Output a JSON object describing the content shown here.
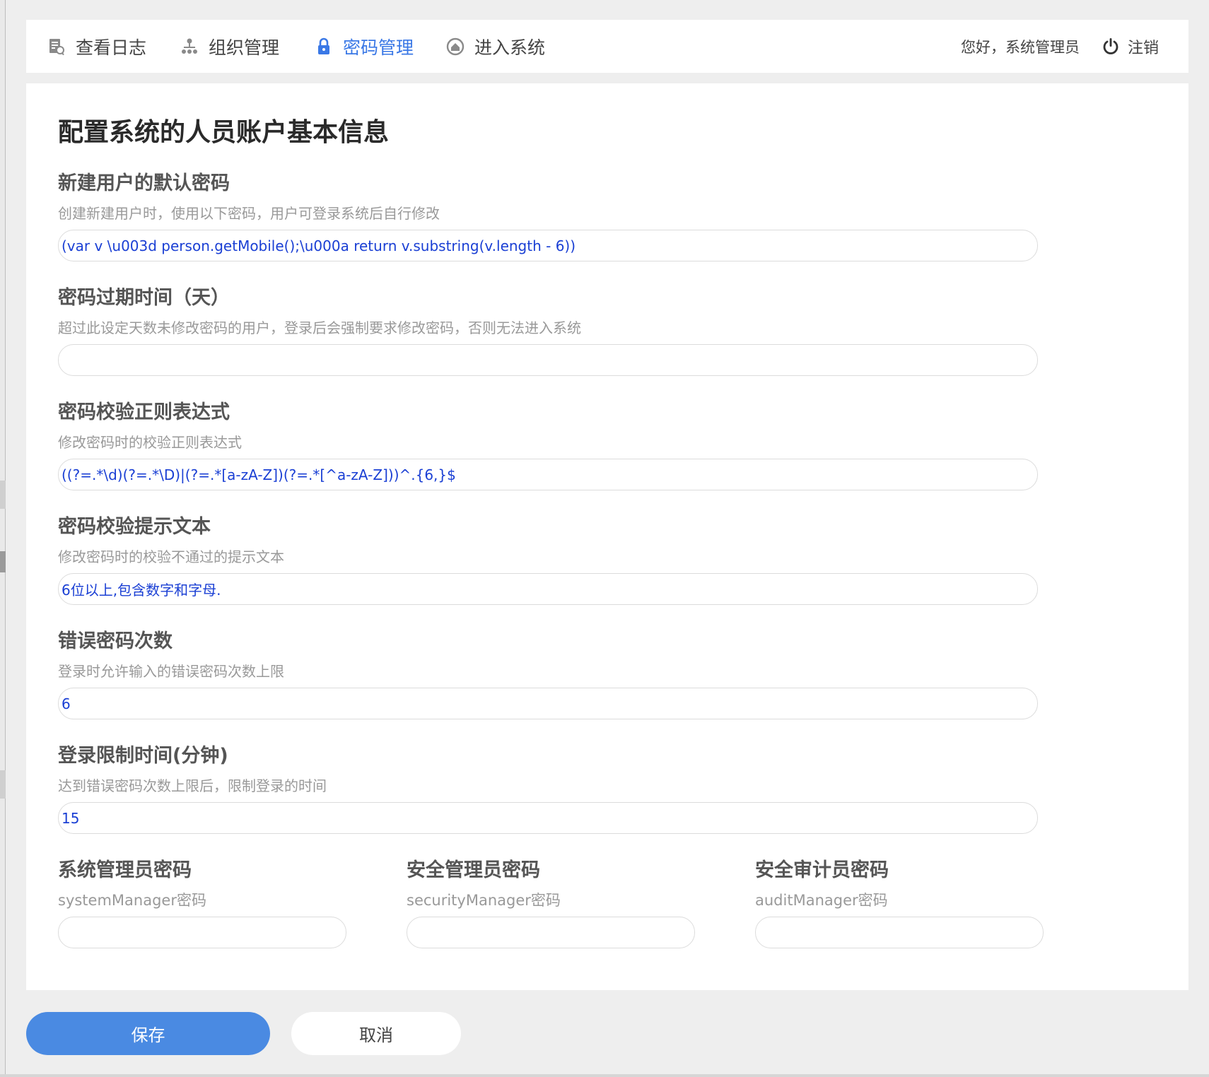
{
  "nav": {
    "items": [
      {
        "label": "查看日志",
        "icon": "log-document-icon"
      },
      {
        "label": "组织管理",
        "icon": "org-tree-icon"
      },
      {
        "label": "密码管理",
        "icon": "lock-icon",
        "active": true
      },
      {
        "label": "进入系统",
        "icon": "home-icon"
      }
    ],
    "greeting": "您好，系统管理员",
    "logout_label": "注销",
    "active_color": "#3a78e6"
  },
  "page": {
    "title": "配置系统的人员账户基本信息"
  },
  "fields": {
    "default_password": {
      "label": "新建用户的默认密码",
      "desc": "创建新建用户时，使用以下密码，用户可登录系统后自行修改",
      "value": "(var v \\u003d person.getMobile();\\u000a return v.substring(v.length - 6))"
    },
    "password_expire_days": {
      "label": "密码过期时间（天）",
      "desc": "超过此设定天数未修改密码的用户，登录后会强制要求修改密码，否则无法进入系统",
      "value": ""
    },
    "password_regex": {
      "label": "密码校验正则表达式",
      "desc": "修改密码时的校验正则表达式",
      "value": "((?=.*\\d)(?=.*\\D)|(?=.*[a-zA-Z])(?=.*[^a-zA-Z]))^.{6,}$"
    },
    "password_hint": {
      "label": "密码校验提示文本",
      "desc": "修改密码时的校验不通过的提示文本",
      "value": "6位以上,包含数字和字母."
    },
    "error_count": {
      "label": "错误密码次数",
      "desc": "登录时允许输入的错误密码次数上限",
      "value": "6"
    },
    "lock_minutes": {
      "label": "登录限制时间(分钟)",
      "desc": "达到错误密码次数上限后，限制登录的时间",
      "value": "15"
    },
    "system_manager": {
      "label": "系统管理员密码",
      "desc": "systemManager密码",
      "value": ""
    },
    "security_manager": {
      "label": "安全管理员密码",
      "desc": "securityManager密码",
      "value": ""
    },
    "audit_manager": {
      "label": "安全审计员密码",
      "desc": "auditManager密码",
      "value": ""
    }
  },
  "buttons": {
    "save_label": "保存",
    "cancel_label": "取消",
    "save_color": "#4a8ae2"
  }
}
